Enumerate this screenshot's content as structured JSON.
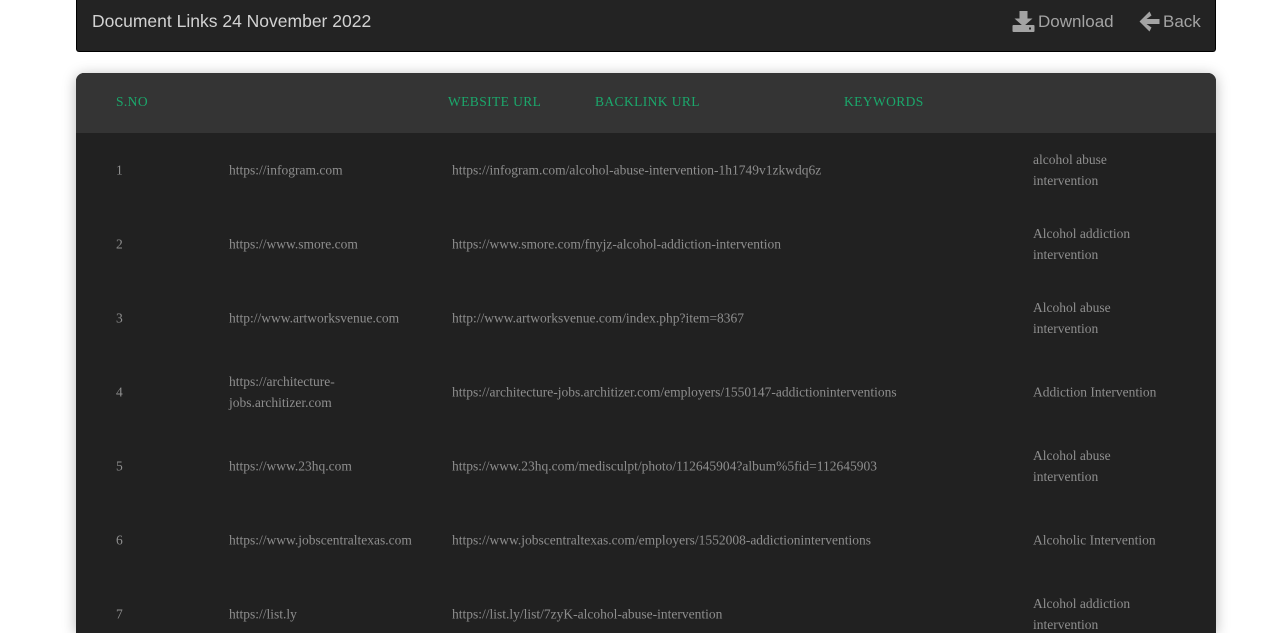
{
  "header": {
    "title": "Document Links 24 November 2022",
    "download_label": "Download",
    "back_label": "Back"
  },
  "table": {
    "columns": [
      "S.NO",
      "WEBSITE URL",
      "BACKLINK URL",
      "KEYWORDS"
    ],
    "rows": [
      {
        "sno": "1",
        "website": "https://infogram.com",
        "backlink": "https://infogram.com/alcohol-abuse-intervention-1h1749v1zkwdq6z",
        "keywords": "alcohol abuse intervention"
      },
      {
        "sno": "2",
        "website": "https://www.smore.com",
        "backlink": "https://www.smore.com/fnyjz-alcohol-addiction-intervention",
        "keywords": "Alcohol addiction intervention"
      },
      {
        "sno": "3",
        "website": "http://www.artworksvenue.com",
        "backlink": "http://www.artworksvenue.com/index.php?item=8367",
        "keywords": "Alcohol abuse intervention"
      },
      {
        "sno": "4",
        "website": "https://architecture-jobs.architizer.com",
        "backlink": "https://architecture-jobs.architizer.com/employers/1550147-addictioninterventions",
        "keywords": "Addiction Intervention"
      },
      {
        "sno": "5",
        "website": "https://www.23hq.com",
        "backlink": "https://www.23hq.com/medisculpt/photo/112645904?album%5fid=112645903",
        "keywords": "Alcohol abuse intervention"
      },
      {
        "sno": "6",
        "website": "https://www.jobscentraltexas.com",
        "backlink": "https://www.jobscentraltexas.com/employers/1552008-addictioninterventions",
        "keywords": "Alcoholic Intervention"
      },
      {
        "sno": "7",
        "website": "https://list.ly",
        "backlink": "https://list.ly/list/7zyK-alcohol-abuse-intervention",
        "keywords": "Alcohol addiction intervention"
      }
    ]
  },
  "colors": {
    "accent": "#1ba76b",
    "panel": "#212121",
    "header_row": "#343434",
    "topbar": "#232323"
  },
  "icons": {
    "download": "download-icon",
    "back": "arrow-left-icon"
  }
}
